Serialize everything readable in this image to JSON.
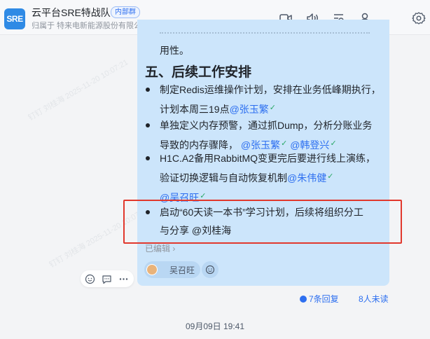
{
  "header": {
    "avatar_text": "SRE",
    "title": "云平台SRE特战队",
    "tag": "内部群",
    "subtitle": "归属于 特来电新能源股份有限公司",
    "icons": [
      "video-icon",
      "voice-icon",
      "search-list-icon",
      "add-member-icon",
      "settings-icon"
    ]
  },
  "message": {
    "prev_fragment": "用性。",
    "section_title": "五、后续工作安排",
    "bullets": [
      {
        "line1": "制定Redis运维操作计划，安排在业务低峰期执行，",
        "line2_text": "计划本周三19点",
        "line2_mentions": [
          "@张玉繁"
        ]
      },
      {
        "line1": "单独定义内存预警，通过抓Dump，分析分账业务",
        "line2_text": "导致的内存骤降，",
        "line2_mentions": [
          "@张玉繁",
          "@韩登兴"
        ]
      },
      {
        "line1": "H1C.A2备用RabbitMQ变更完后要进行线上演练，",
        "line2_text": "验证切换逻辑与自动恢复机制",
        "line2_mentions": [
          "@朱伟健"
        ],
        "line3_mentions": [
          "@吴召旺"
        ]
      },
      {
        "line1": "启动“60天读一本书”学习计划，后续将组织分工",
        "line2_text": "与分享 @刘桂海"
      }
    ],
    "edited_label": "已编辑 ›",
    "reader_name": "吴召旺"
  },
  "footer": {
    "replies": "7条回复",
    "unread": "8人未读",
    "timestamp": "09月09日  19:41"
  },
  "watermark_text": "钉钉 刘桂海 2025-11-20 10:07:21",
  "colors": {
    "accent": "#2d6ff0",
    "bubble": "#cce5fb",
    "highlight": "#e1382d",
    "check": "#2aa866"
  }
}
